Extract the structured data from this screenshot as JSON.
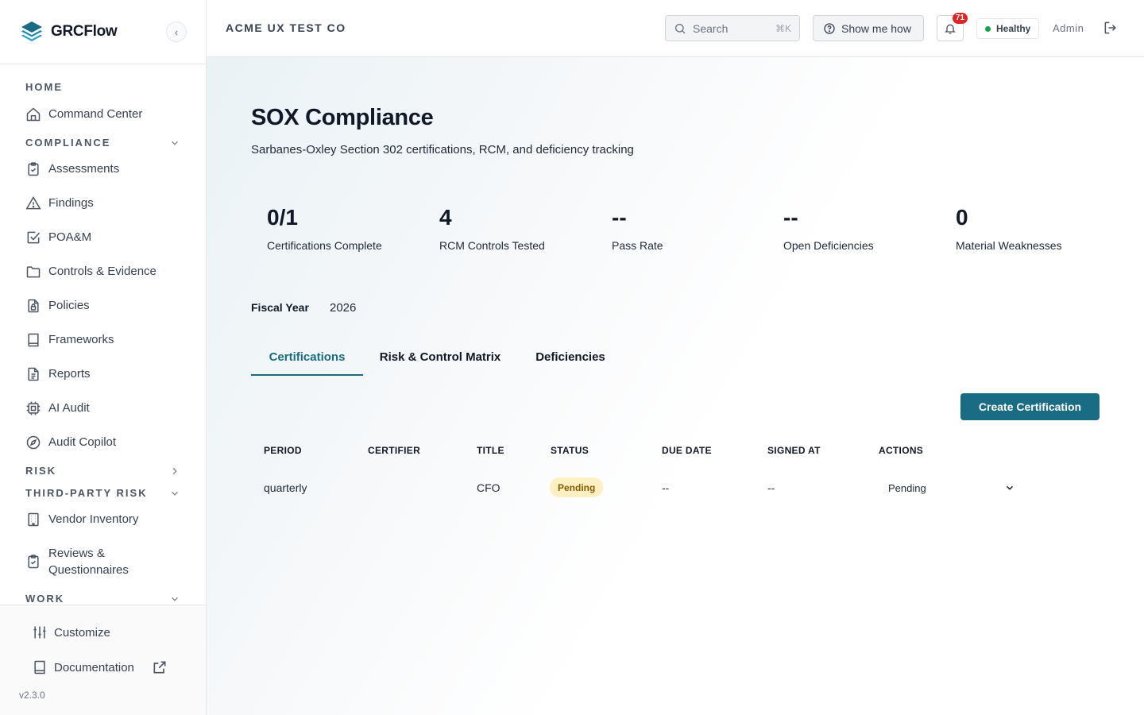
{
  "app": {
    "name": "GRCFlow",
    "version": "v2.3.0"
  },
  "header": {
    "org": "ACME UX TEST CO",
    "search_placeholder": "Search",
    "search_shortcut": "⌘K",
    "help_label": "Show me how",
    "notification_count": "71",
    "health_label": "Healthy",
    "health_color": "#16a34a",
    "user_label": "Admin"
  },
  "sidebar": {
    "sections": {
      "home": "HOME",
      "compliance": "COMPLIANCE",
      "risk": "RISK",
      "third_party": "THIRD-PARTY RISK",
      "work": "WORK"
    },
    "items": {
      "command_center": "Command Center",
      "assessments": "Assessments",
      "findings": "Findings",
      "poam": "POA&M",
      "controls": "Controls & Evidence",
      "policies": "Policies",
      "frameworks": "Frameworks",
      "reports": "Reports",
      "ai_audit": "AI Audit",
      "audit_copilot": "Audit Copilot",
      "vendor_inventory": "Vendor Inventory",
      "reviews_line1": "Reviews &",
      "reviews_line2": "Questionnaires"
    },
    "footer": {
      "customize": "Customize",
      "documentation": "Documentation"
    }
  },
  "page": {
    "title": "SOX Compliance",
    "subtitle": "Sarbanes-Oxley Section 302 certifications, RCM, and deficiency tracking",
    "stats": [
      {
        "value": "0/1",
        "label": "Certifications Complete"
      },
      {
        "value": "4",
        "label": "RCM Controls Tested"
      },
      {
        "value": "--",
        "label": "Pass Rate"
      },
      {
        "value": "--",
        "label": "Open Deficiencies"
      },
      {
        "value": "0",
        "label": "Material Weaknesses"
      }
    ],
    "fiscal_year_label": "Fiscal Year",
    "fiscal_year_value": "2026",
    "tabs": [
      "Certifications",
      "Risk & Control Matrix",
      "Deficiencies"
    ],
    "active_tab": "Certifications",
    "create_button": "Create Certification",
    "accent_color": "#1a6b84",
    "table": {
      "headers": [
        "PERIOD",
        "CERTIFIER",
        "TITLE",
        "STATUS",
        "DUE DATE",
        "SIGNED AT",
        "ACTIONS"
      ],
      "rows": [
        {
          "period": "quarterly",
          "certifier": "",
          "title": "CFO",
          "status": "Pending",
          "due_date": "--",
          "signed_at": "--",
          "action": "Pending"
        }
      ]
    }
  }
}
